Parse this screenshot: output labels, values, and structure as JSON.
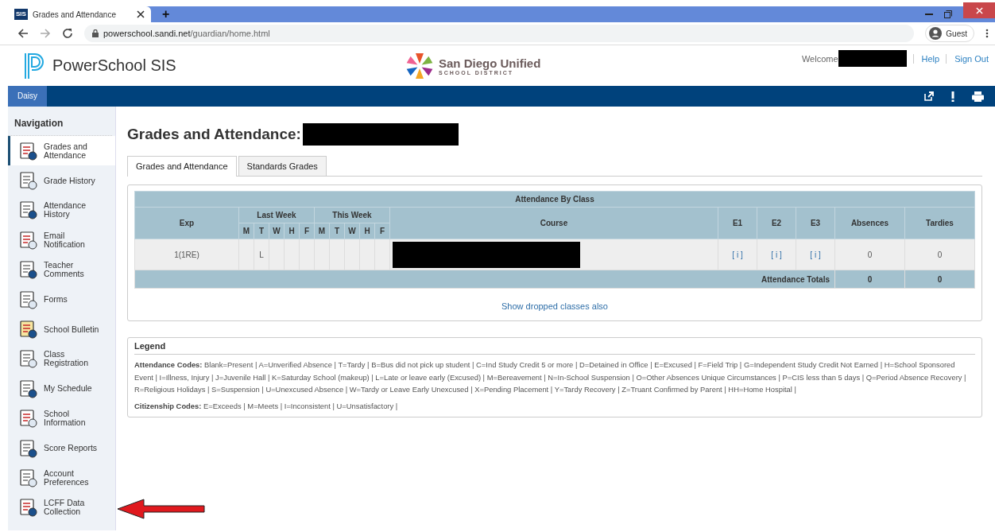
{
  "browser": {
    "tab_title": "Grades and Attendance",
    "favicon": "SIS",
    "new_tab": "+",
    "url_host": "powerschool.sandi.net",
    "url_path": "/guardian/home.html",
    "profile": "Guest"
  },
  "header": {
    "product": "PowerSchool SIS",
    "district_name": "San Diego Unified",
    "district_sub": "SCHOOL DISTRICT",
    "welcome": "Welcome",
    "links": [
      "Help",
      "Sign Out"
    ]
  },
  "student_tab": "Daisy",
  "navigation": {
    "title": "Navigation",
    "items": [
      {
        "label": "Grades and Attendance",
        "selected": true
      },
      {
        "label": "Grade History",
        "selected": false
      },
      {
        "label": "Attendance History",
        "selected": false
      },
      {
        "label": "Email Notification",
        "selected": false
      },
      {
        "label": "Teacher Comments",
        "selected": false
      },
      {
        "label": "Forms",
        "selected": false
      },
      {
        "label": "School Bulletin",
        "selected": false
      },
      {
        "label": "Class Registration",
        "selected": false
      },
      {
        "label": "My Schedule",
        "selected": false
      },
      {
        "label": "School Information",
        "selected": false
      },
      {
        "label": "Score Reports",
        "selected": false
      },
      {
        "label": "Account Preferences",
        "selected": false
      },
      {
        "label": "LCFF Data Collection",
        "selected": false
      }
    ]
  },
  "page_title": "Grades and Attendance:",
  "tabs": [
    {
      "label": "Grades and Attendance",
      "selected": true
    },
    {
      "label": "Standards Grades",
      "selected": false
    }
  ],
  "table": {
    "title": "Attendance By Class",
    "columns": {
      "exp": "Exp",
      "last_week": "Last Week",
      "this_week": "This Week",
      "days": [
        "M",
        "T",
        "W",
        "H",
        "F",
        "M",
        "T",
        "W",
        "H",
        "F"
      ],
      "course": "Course",
      "e": [
        "E1",
        "E2",
        "E3"
      ],
      "absences": "Absences",
      "tardies": "Tardies"
    },
    "rows": [
      {
        "exp": "1(1RE)",
        "day_cells": [
          {
            "kind": "blank"
          },
          {
            "kind": "code",
            "code": "L"
          },
          {
            "kind": "blank"
          },
          {
            "kind": "blank"
          },
          {
            "kind": "blank"
          },
          {
            "kind": "blank"
          },
          {
            "kind": "blank"
          },
          {
            "kind": "blank"
          },
          {
            "kind": "blank"
          },
          {
            "kind": "blank"
          }
        ],
        "e": [
          "[ i ]",
          "[ i ]",
          "[ i ]"
        ],
        "absences": "0",
        "tardies": "0"
      }
    ],
    "totals": {
      "label": "Attendance Totals",
      "absences": "0",
      "tardies": "0"
    }
  },
  "dropped_link": "Show dropped classes also",
  "legend": {
    "title": "Legend",
    "paragraphs": [
      "**Attendance Codes:**  Blank=Present | A=Unverified Absence | T=Tardy | B=Bus did not pick up student | C=Ind Study Credit 5 or more | D=Detained in Office | E=Excused | F=Field Trip | G=Independent Study Credit Not Earned | H=School Sponsored Event | I=Illness, Injury | J=Juvenile Hall | K=Saturday School (makeup) | L=Late or leave early (Excused) | M=Bereavement | N=In-School Suspension | O=Other Absences Unique Circumstances | P=CIS less than 5 days | Q=Period Absence Recovery | R=Religious Holidays | S=Suspension | U=Unexcused Absence | W=Tardy or Leave Early Unexcused | X=Pending Placement | Y=Tardy Recovery | Z=Truant Confirmed by Parent | HH=Home Hospital |",
      "**Citizenship Codes:**  E=Exceeds | M=Meets | I=Inconsistent | U=Unsatisfactory |"
    ]
  }
}
